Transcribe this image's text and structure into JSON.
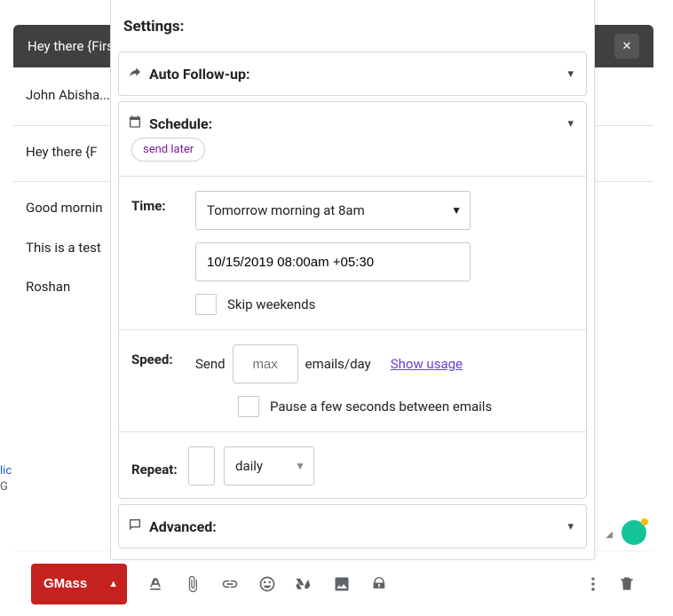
{
  "compose": {
    "subject": "Hey there {FirstName}",
    "to": "John Abisha...",
    "line_greeting": "Hey there {F",
    "line_morning": "Good mornin",
    "line_test": "This is a test",
    "line_name": "Roshan"
  },
  "settings": {
    "title": "Settings:",
    "auto_followup": {
      "label": "Auto Follow-up:"
    },
    "schedule": {
      "label": "Schedule:",
      "pill": "send later",
      "time_label": "Time:",
      "time_select": "Tomorrow morning at 8am",
      "time_value": "10/15/2019 08:00am +05:30",
      "skip_weekends": "Skip weekends",
      "speed_label": "Speed:",
      "speed_send": "Send",
      "speed_placeholder": "max",
      "speed_suffix": "emails/day",
      "speed_link": "Show usage",
      "pause_label": "Pause a few seconds between emails",
      "repeat_label": "Repeat:",
      "repeat_unit": "daily"
    },
    "advanced": {
      "label": "Advanced:"
    }
  },
  "toolbar": {
    "gmass": "GMass"
  }
}
